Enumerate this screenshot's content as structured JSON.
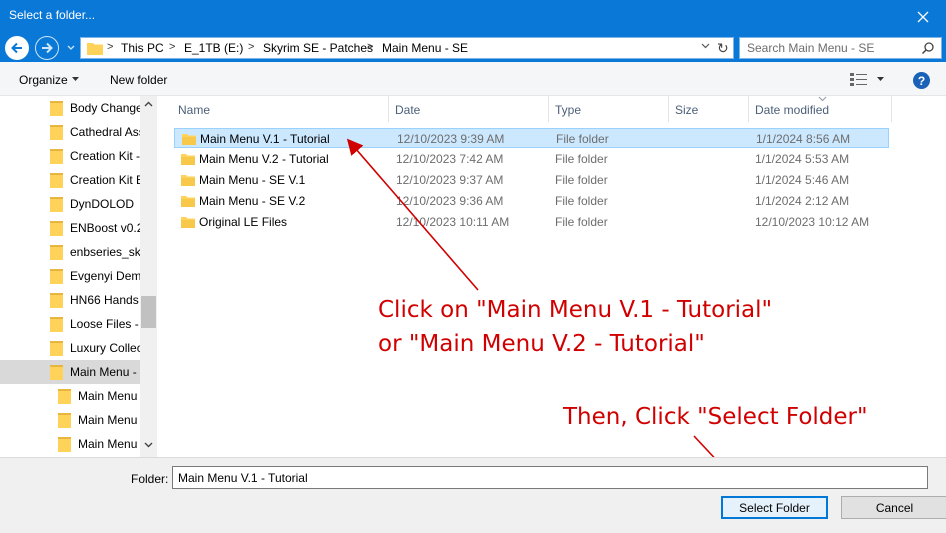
{
  "window": {
    "title": "Select a folder...",
    "close_icon": "close-icon"
  },
  "nav": {
    "back_icon": "arrow-left-icon",
    "forward_icon": "arrow-right-icon",
    "recent_icon": "chevron-down-icon",
    "breadcrumbs": [
      "This PC",
      "E_1TB (E:)",
      "Skyrim SE - Patches",
      "Main Menu - SE"
    ],
    "refresh_icon": "refresh-icon",
    "search_placeholder": "Search Main Menu - SE",
    "search_icon": "search-icon"
  },
  "toolbar": {
    "organize_label": "Organize",
    "new_folder_label": "New folder",
    "help_label": "?"
  },
  "sidebar": {
    "items": [
      {
        "label": "Body Change",
        "indent": 1
      },
      {
        "label": "Cathedral Ass",
        "indent": 1
      },
      {
        "label": "Creation Kit -",
        "indent": 1
      },
      {
        "label": "Creation Kit E",
        "indent": 1
      },
      {
        "label": "DynDOLOD",
        "indent": 1
      },
      {
        "label": "ENBoost v0.2",
        "indent": 1
      },
      {
        "label": "enbseries_sky",
        "indent": 1
      },
      {
        "label": "Evgenyi Dem",
        "indent": 1
      },
      {
        "label": "HN66 Hands",
        "indent": 1
      },
      {
        "label": "Loose Files - I",
        "indent": 1
      },
      {
        "label": "Luxury Collec",
        "indent": 1
      },
      {
        "label": "Main Menu -",
        "indent": 1,
        "selected": true
      },
      {
        "label": "Main Menu",
        "indent": 2
      },
      {
        "label": "Main Menu",
        "indent": 2
      },
      {
        "label": "Main Menu",
        "indent": 2
      }
    ]
  },
  "columns": [
    "Name",
    "Date",
    "Type",
    "Size",
    "Date modified"
  ],
  "rows": [
    {
      "name": "Main Menu V.1 - Tutorial",
      "date": "12/10/2023 9:39 AM",
      "type": "File folder",
      "size": "",
      "modified": "1/1/2024 8:56 AM",
      "selected": true
    },
    {
      "name": "Main Menu V.2 - Tutorial",
      "date": "12/10/2023 7:42 AM",
      "type": "File folder",
      "size": "",
      "modified": "1/1/2024 5:53 AM"
    },
    {
      "name": "Main Menu - SE V.1",
      "date": "12/10/2023 9:37 AM",
      "type": "File folder",
      "size": "",
      "modified": "1/1/2024 5:46 AM"
    },
    {
      "name": "Main Menu - SE V.2",
      "date": "12/10/2023 9:36 AM",
      "type": "File folder",
      "size": "",
      "modified": "1/1/2024 2:12 AM"
    },
    {
      "name": "Original LE Files",
      "date": "12/10/2023 10:11 AM",
      "type": "File folder",
      "size": "",
      "modified": "12/10/2023 10:12 AM"
    }
  ],
  "annotations": {
    "line1": "Click on \"Main Menu V.1 - Tutorial\"",
    "line2": "or \"Main Menu V.2 - Tutorial\"",
    "line3": "Then, Click \"Select Folder\"",
    "color": "#d10000"
  },
  "footer": {
    "folder_label": "Folder:",
    "folder_value": "Main Menu V.1 - Tutorial",
    "select_label": "Select Folder",
    "cancel_label": "Cancel"
  },
  "colors": {
    "titlebar": "#0a78d7",
    "selection": "#cce8ff",
    "folder_icon": "#ffd35a"
  }
}
